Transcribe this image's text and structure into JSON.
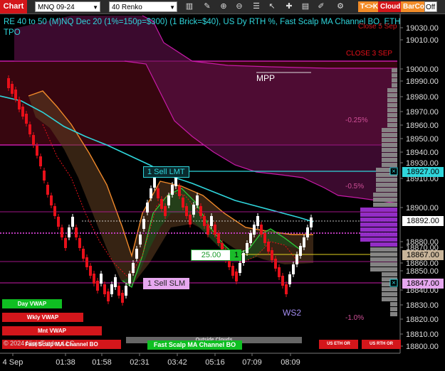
{
  "toolbar": {
    "chart_tab": "Chart",
    "instrument": "MNQ 09-24",
    "bar_type": "40 Renko",
    "tk_button": "T<>K",
    "cloud_button": "Cloud",
    "barcol_button": "BarCol",
    "off_toggle": "Off",
    "icons": [
      "instrument-dropdown-icon",
      "bartype-dropdown-icon",
      "bar-chart-icon",
      "settings-icon",
      "zoom-icon",
      "zoom-out-icon",
      "properties-icon",
      "pointer-icon",
      "crosshair-icon",
      "text-icon",
      "drawing-icon",
      "strategy-icon"
    ]
  },
  "header": {
    "line1": "RE 40 to 50 (M)NQ Dec 20 (1%=150p=$300) (1 Brick=$40), US Dy RTH %, Fast Scalp MA Channel BO, ETH",
    "line2": "TPO",
    "corner_red": "Close 5 Sep"
  },
  "annotations": {
    "close": "CLOSE 3 SEP",
    "mpp": "MPP",
    "pct_025": "-0.25%",
    "pct_05": "-0.5%",
    "pct_1": "-1.0%",
    "ws2": "WS2",
    "watermark": "© 2024 NinjaTrader, LLC",
    "outside_clouds": "Outside Clouds",
    "fast_scalp_small": "Fast Scalp MA Channel BO"
  },
  "orders": {
    "sell_lmt": "1 Sell LMT",
    "sell_slm": "1 Sell SLM",
    "quantity": "25.00",
    "count": "1"
  },
  "buttons": {
    "day_vwap": "Day VWAP",
    "wkly_vwap": "Wkly VWAP",
    "mnt_vwap": "Mnt VWAP",
    "fast_scalp": "Fast Scalp MA Channel BO",
    "us_eth_or": "US ETH OR",
    "us_rth_or": "US RTH OR"
  },
  "price_axis": {
    "ticks": [
      "19030.00",
      "19010.00",
      "19000.00",
      "18990.00",
      "18980.00",
      "18970.00",
      "18960.00",
      "18950.00",
      "18940.00",
      "18930.00",
      "18910.00",
      "18900.00",
      "18880.00",
      "18870.00",
      "18860.00",
      "18850.00",
      "18840.00",
      "18830.00",
      "18820.00",
      "18810.00",
      "18800.00"
    ],
    "labels": {
      "sell_lmt_price": "18927.00",
      "current_price": "18892.00",
      "entry_price": "18867.00",
      "stop_price": "18847.00"
    }
  },
  "time_axis": [
    "4 Sep",
    "01:38",
    "01:58",
    "02:31",
    "03:42",
    "05:16",
    "07:09",
    "08:09"
  ],
  "colors": {
    "bull": "#ffffff",
    "bear": "#e8101a",
    "cyan": "#2fd6dc",
    "orange": "#f0892a",
    "magenta": "#c71aa8",
    "purple_profile": "#9b2fd0",
    "grey_profile": "#8a8a8a",
    "tab_red": "#d4161b"
  }
}
